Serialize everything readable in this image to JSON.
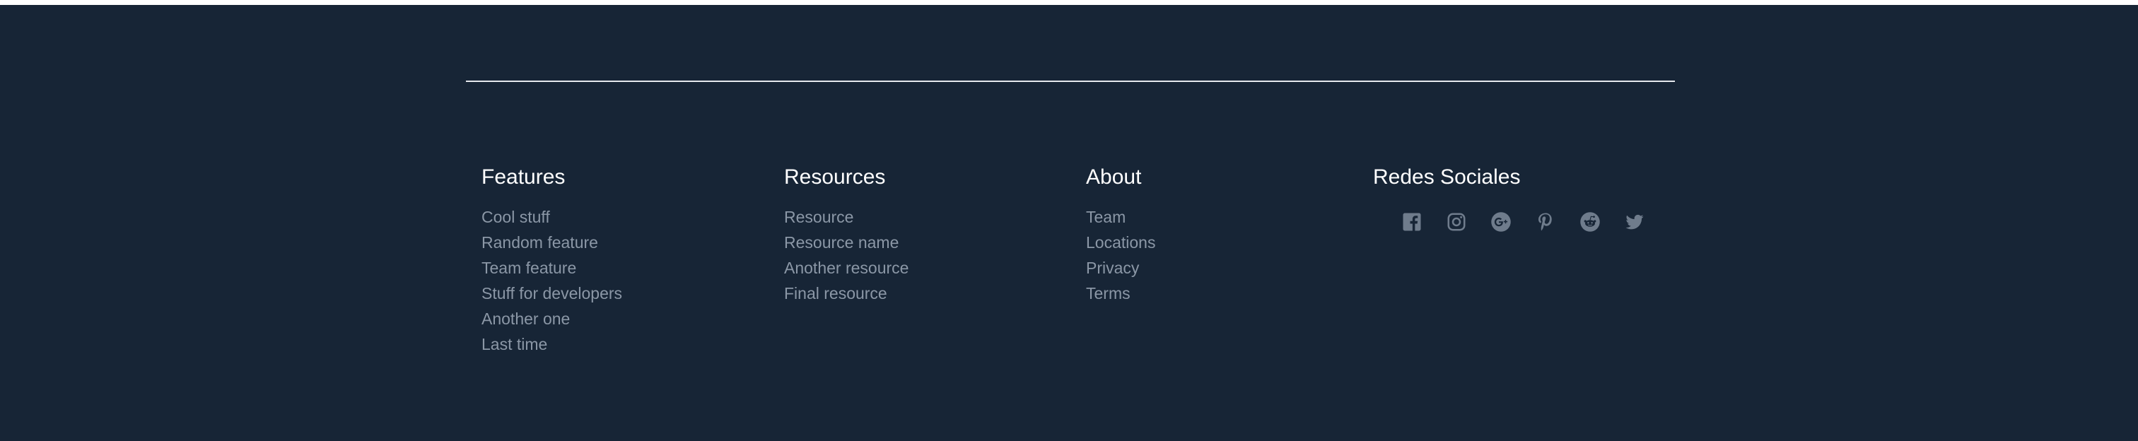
{
  "colors": {
    "background": "#172536",
    "heading": "#ffffff",
    "link": "#8b97a6",
    "icon": "#6f7c8c",
    "rule": "#e6e9ee"
  },
  "features": {
    "title": "Features",
    "items": [
      "Cool stuff",
      "Random feature",
      "Team feature",
      "Stuff for developers",
      "Another one",
      "Last time"
    ]
  },
  "resources": {
    "title": "Resources",
    "items": [
      "Resource",
      "Resource name",
      "Another resource",
      "Final resource"
    ]
  },
  "about": {
    "title": "About",
    "items": [
      "Team",
      "Locations",
      "Privacy",
      "Terms"
    ]
  },
  "social": {
    "title": "Redes Sociales",
    "icons": [
      "facebook-icon",
      "instagram-icon",
      "google-plus-icon",
      "pinterest-icon",
      "reddit-icon",
      "twitter-icon"
    ]
  }
}
